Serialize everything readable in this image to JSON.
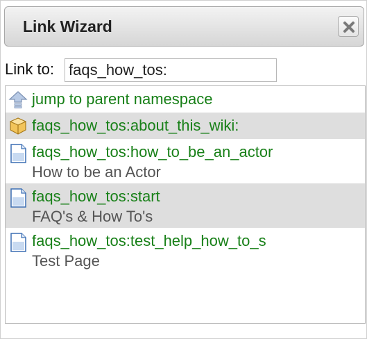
{
  "dialog": {
    "title": "Link Wizard",
    "close_icon": "close-icon"
  },
  "link_to": {
    "label": "Link to:",
    "value": "faqs_how_tos:"
  },
  "results": [
    {
      "icon": "parent-namespace-icon",
      "link": "jump to parent namespace",
      "description": ""
    },
    {
      "icon": "namespace-folder-icon",
      "link": "faqs_how_tos:about_this_wiki:",
      "description": ""
    },
    {
      "icon": "page-icon",
      "link": "faqs_how_tos:how_to_be_an_actor",
      "description": "How to be an Actor"
    },
    {
      "icon": "page-icon",
      "link": "faqs_how_tos:start",
      "description": "FAQ's & How To's"
    },
    {
      "icon": "page-icon",
      "link": "faqs_how_tos:test_help_how_to_s",
      "description": "Test Page"
    }
  ],
  "colors": {
    "link": "#188018",
    "description": "#555555",
    "alt_row": "#dedede"
  }
}
